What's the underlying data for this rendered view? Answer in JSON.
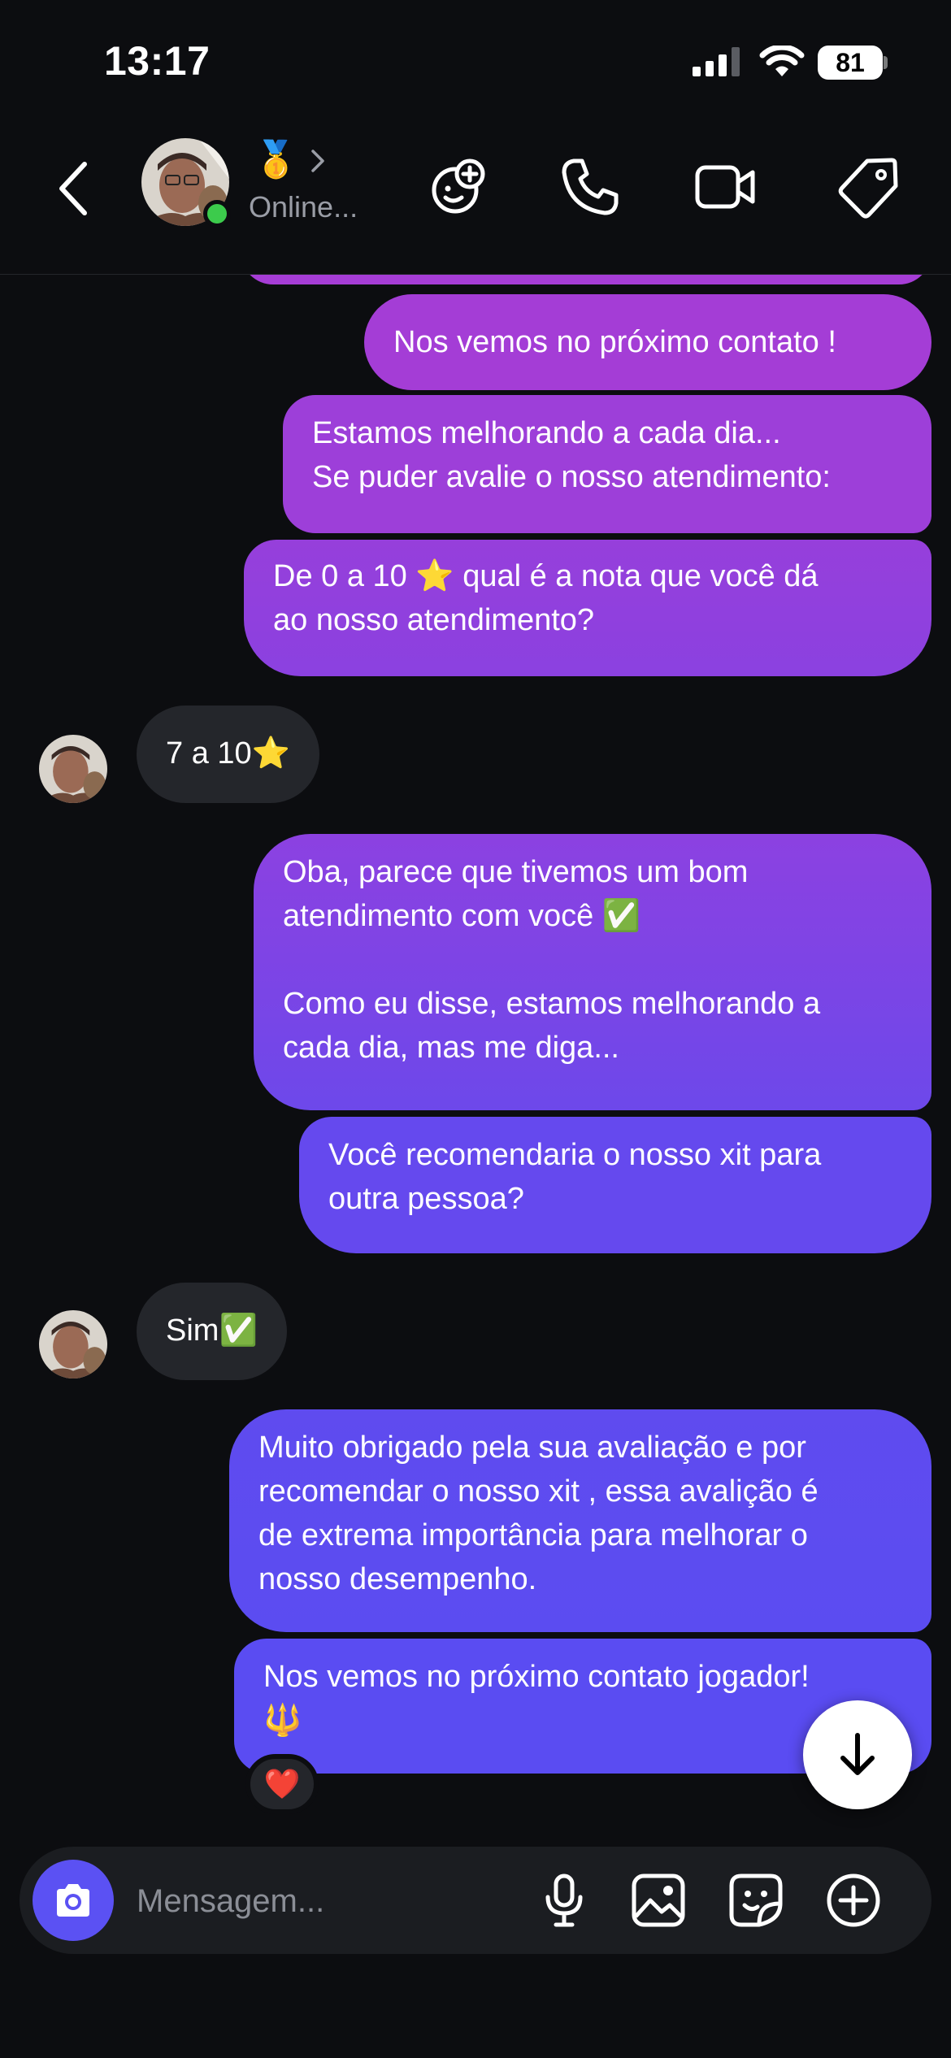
{
  "status_bar": {
    "time": "13:17",
    "battery": "81"
  },
  "header": {
    "status": "Online...",
    "badge_emoji": "🥇"
  },
  "messages": [
    {
      "from": "me",
      "text": "Nos vemos no próximo contato !"
    },
    {
      "from": "me",
      "text": "Estamos melhorando a cada dia...\nSe puder avalie o nosso atendimento:"
    },
    {
      "from": "me",
      "text": "De 0 a 10 ⭐ qual é a nota que você dá\nao nosso atendimento?"
    },
    {
      "from": "them",
      "text": "7 a 10⭐"
    },
    {
      "from": "me",
      "text": "Oba, parece que tivemos um bom\natendimento com você ✅\n\nComo eu disse, estamos melhorando a\ncada dia, mas me diga..."
    },
    {
      "from": "me",
      "text": "Você recomendaria o nosso xit para\noutra pessoa?"
    },
    {
      "from": "them",
      "text": "Sim✅"
    },
    {
      "from": "me",
      "text": "Muito obrigado pela sua avaliação e por\nrecomendar o nosso xit , essa avalição é\nde extrema importância para melhorar o\nnosso desempenho."
    },
    {
      "from": "me",
      "text": "Nos vemos no próximo contato jogador!\n🔱"
    }
  ],
  "reaction": "❤️",
  "composer": {
    "placeholder": "Mensagem..."
  },
  "colors": {
    "background": "#0c0d10",
    "incoming_bubble": "#24262b",
    "outgoing_top": "#a63dd6",
    "outgoing_bottom": "#5b51f3",
    "online": "#3ccb4c"
  },
  "icons": [
    "back-icon",
    "chevron-right-icon",
    "add-effects-icon",
    "phone-icon",
    "video-camera-icon",
    "tag-icon",
    "camera-icon",
    "microphone-icon",
    "image-icon",
    "sticker-icon",
    "plus-circle-icon",
    "arrow-down-icon"
  ]
}
